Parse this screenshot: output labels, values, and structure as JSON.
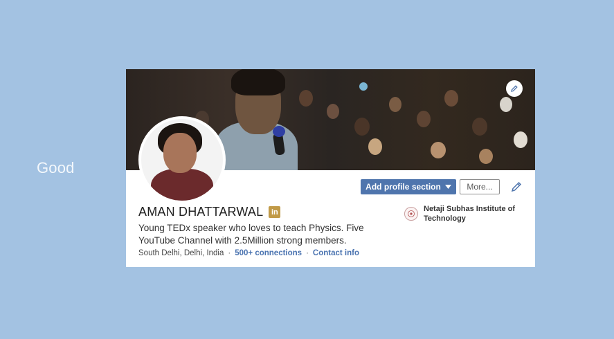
{
  "slide": {
    "label": "Good"
  },
  "profile": {
    "name": "AMAN DHATTARWAL",
    "linkedin_badge": "in",
    "headline": "Young TEDx speaker who loves to teach Physics. Five YouTube Channel with 2.5Million strong members.",
    "location": "South Delhi, Delhi, India",
    "connections": "500+ connections",
    "contact_info": "Contact info",
    "separator": "·"
  },
  "actions": {
    "add_section": "Add profile section",
    "more": "More..."
  },
  "education": {
    "school": "Netaji Subhas Institute of Technology"
  },
  "colors": {
    "background": "#a3c2e2",
    "primary_button": "#4f75ad",
    "link": "#4a73b0",
    "badge": "#c19a47"
  }
}
